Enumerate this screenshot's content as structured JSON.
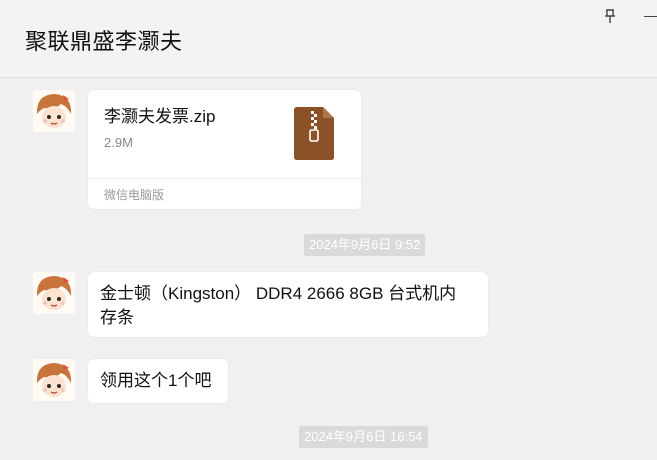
{
  "header": {
    "title": "聚联鼎盛李灏夫"
  },
  "messages": {
    "file": {
      "name": "李灏夫发票.zip",
      "size": "2.9M",
      "source": "微信电脑版"
    },
    "time1": "2024年9月6日 9:52",
    "msg1_line1": "金士顿（Kingston） DDR4 2666 8GB 台式机内",
    "msg1_line2": "存条",
    "msg2": "领用这个1个吧",
    "time2": "2024年9月6日 16:54"
  },
  "colors": {
    "background": "#f0f0f0",
    "bubble": "#ffffff",
    "zip_brown": "#8b5227",
    "timestamp_bg": "#dadada"
  },
  "icons": [
    "pin-icon",
    "minimize-icon",
    "zip-file-icon",
    "avatar-image"
  ]
}
